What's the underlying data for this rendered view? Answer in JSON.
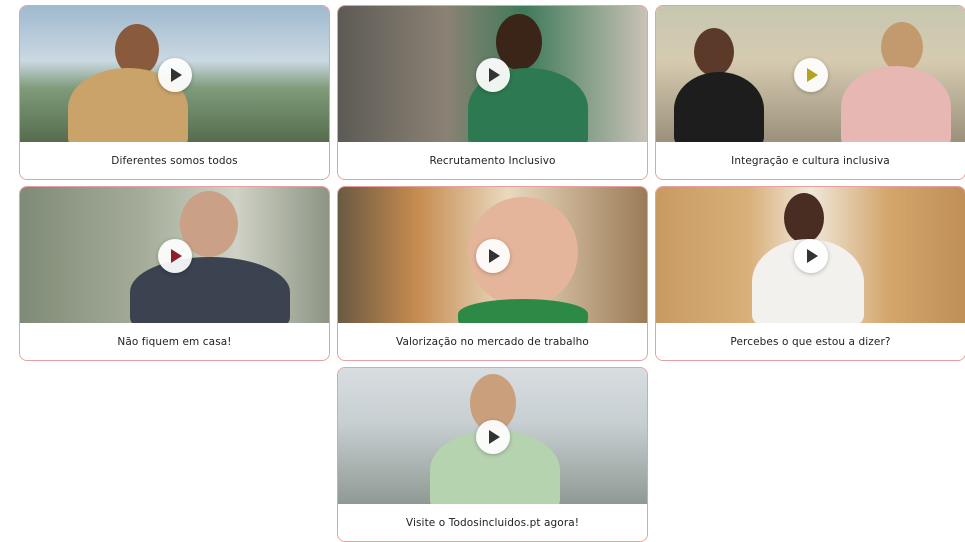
{
  "videos": [
    {
      "title": "Diferentes somos todos",
      "play_color": "#333333"
    },
    {
      "title": "Recrutamento Inclusivo",
      "play_color": "#333333"
    },
    {
      "title": "Integração e cultura inclusiva",
      "play_color": "#b7a21e"
    },
    {
      "title": "Não fiquem em casa!",
      "play_color": "#8e1f2a"
    },
    {
      "title": "Valorização no mercado de trabalho",
      "play_color": "#333333"
    },
    {
      "title": "Percebes o que estou a dizer?",
      "play_color": "#333333"
    },
    {
      "title": "Visite o Todosincluidos.pt agora!",
      "play_color": "#333333"
    }
  ],
  "accent": "#e7a0a0"
}
